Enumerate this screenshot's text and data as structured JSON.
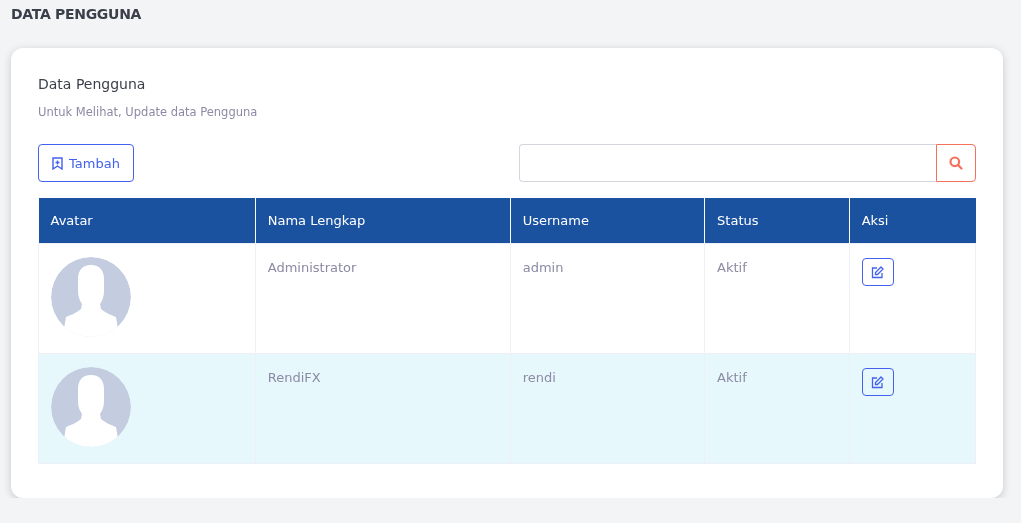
{
  "page_title": "DATA PENGGUNA",
  "card": {
    "title": "Data Pengguna",
    "subtitle": "Untuk Melihat, Update data Pengguna"
  },
  "add_button": {
    "label": "Tambah"
  },
  "table": {
    "columns": [
      "Avatar",
      "Nama Lengkap",
      "Username",
      "Status",
      "Aksi"
    ],
    "rows": [
      {
        "name": "Administrator",
        "username": "admin",
        "status": "Aktif",
        "highlighted": false
      },
      {
        "name": "RendiFX",
        "username": "rendi",
        "status": "Aktif",
        "highlighted": true
      }
    ]
  }
}
